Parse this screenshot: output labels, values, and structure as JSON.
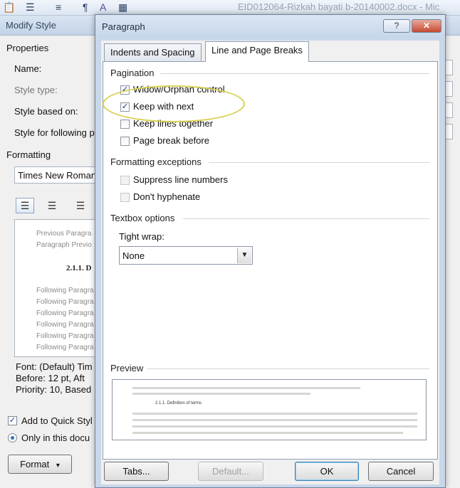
{
  "ribbon": {
    "document_title": "EID012064-Rizkah bayati b-20140002.docx - Mic",
    "icons": [
      "paste-icon",
      "numbering-icon",
      "bullets-icon",
      "pilcrow-icon",
      "styles-icon",
      "table-icon"
    ]
  },
  "modify_style": {
    "title": "Modify Style",
    "properties_label": "Properties",
    "name_label": "Name:",
    "style_type_label": "Style type:",
    "style_based_on_label": "Style based on:",
    "style_following_label": "Style for following p",
    "formatting_label": "Formatting",
    "font_value": "Times New Roman",
    "preview_prev_1": "Previous Paragra",
    "preview_prev_2": "Paragraph Previo",
    "preview_heading": "2.1.1. D",
    "preview_following": [
      "Following Paragra",
      "Following Paragra",
      "Following Paragra",
      "Following Paragra",
      "Following Paragra",
      "Following Paragra"
    ],
    "description_lines": [
      "Font: (Default) Tim",
      "Before: 12 pt, Aft",
      "Priority: 10, Based"
    ],
    "add_to_quick_style_label": "Add to Quick Styl",
    "only_in_this_doc_label": "Only in this docu",
    "format_button_label": "Format",
    "format_button_arrow": "▾"
  },
  "paragraph": {
    "title": "Paragraph",
    "help_button": "?",
    "close_button": "✕",
    "tabs": [
      {
        "label": "Indents and Spacing",
        "active": false
      },
      {
        "label": "Line and Page Breaks",
        "active": true
      }
    ],
    "pagination_label": "Pagination",
    "pagination_options": [
      {
        "label": "Widow/Orphan control",
        "checked": true
      },
      {
        "label": "Keep with next",
        "checked": true
      },
      {
        "label": "Keep lines together",
        "checked": false
      },
      {
        "label": "Page break before",
        "checked": false
      }
    ],
    "formatting_exceptions_label": "Formatting exceptions",
    "exception_options": [
      {
        "label": "Suppress line numbers",
        "checked": false
      },
      {
        "label": "Don't hyphenate",
        "checked": false
      }
    ],
    "textbox_options_label": "Textbox options",
    "tight_wrap_label": "Tight wrap:",
    "tight_wrap_value": "None",
    "preview_label": "Preview",
    "preview_heading": "2.1.1. Definition of terms",
    "buttons": {
      "tabs": "Tabs...",
      "default": "Default...",
      "ok": "OK",
      "cancel": "Cancel"
    }
  },
  "colors": {
    "highlight": "#d9d052",
    "dialog_frame": "#c9d7ea",
    "ok_border": "#3c7fb1"
  }
}
